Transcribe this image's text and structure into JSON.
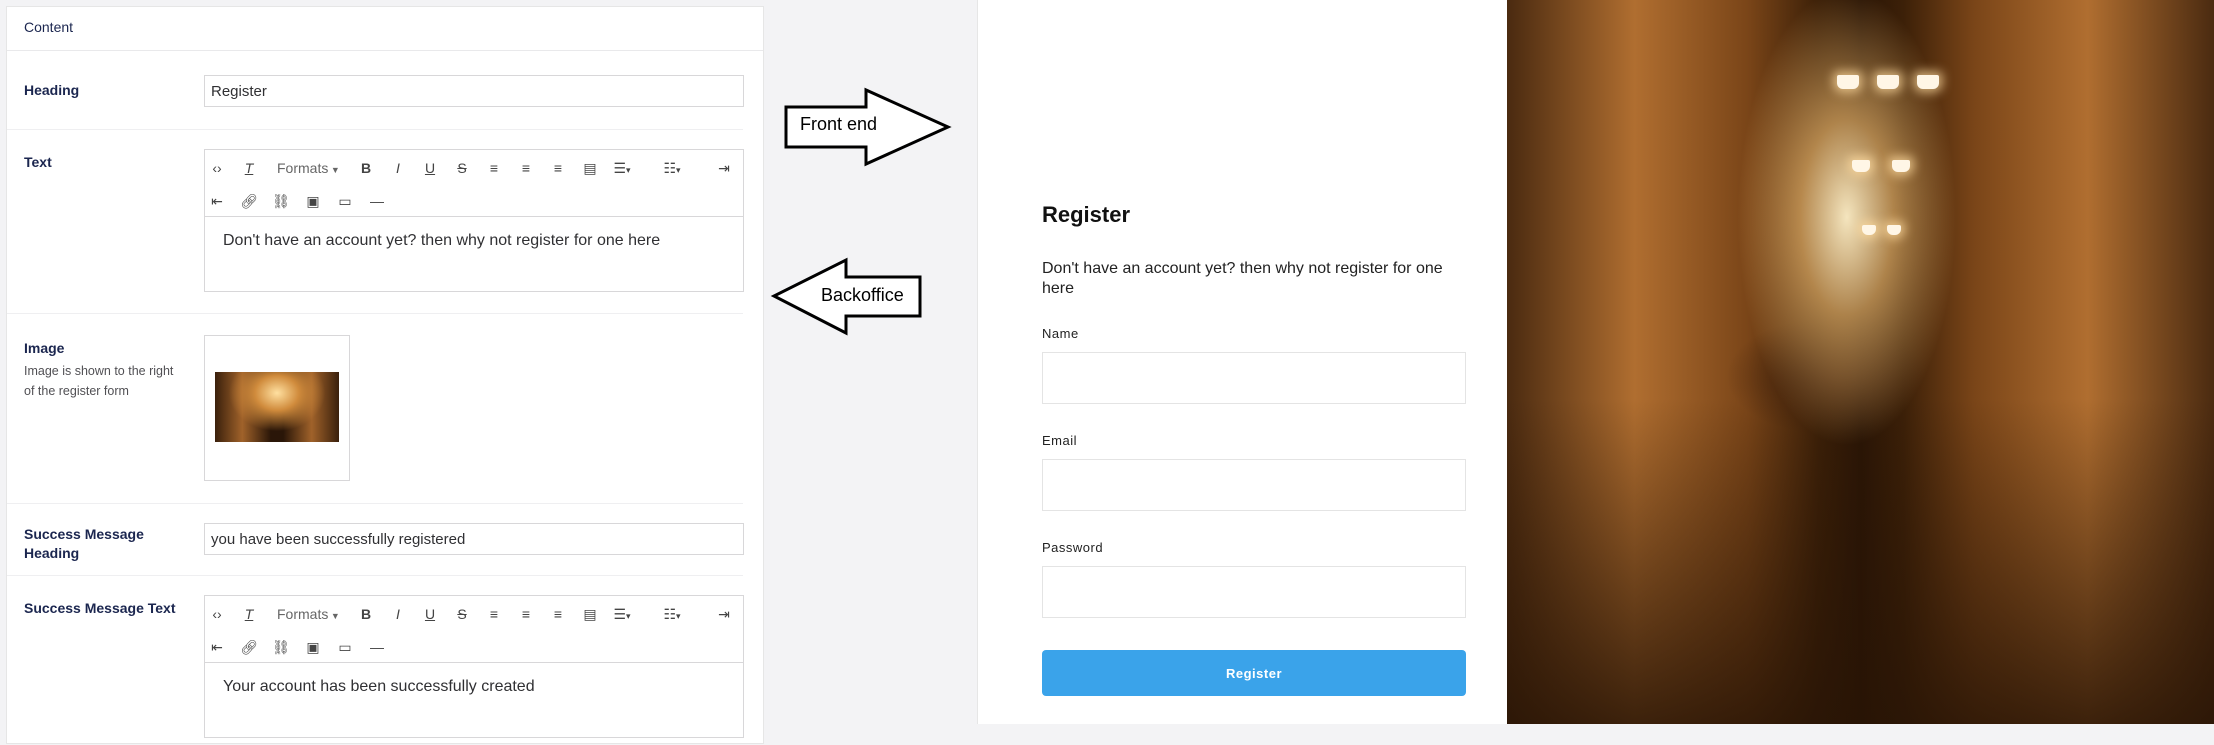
{
  "backoffice": {
    "header": "Content",
    "heading": {
      "label": "Heading",
      "value": "Register"
    },
    "text": {
      "label": "Text",
      "toolbar": {
        "formats": "Formats"
      },
      "value": "Don't have an account yet? then why not register for one here"
    },
    "image": {
      "label": "Image",
      "description": "Image is shown to the right of the register form"
    },
    "success_heading": {
      "label": "Success Message Heading",
      "value": "you have been successfully registered"
    },
    "success_text": {
      "label": "Success Message Text",
      "toolbar": {
        "formats": "Formats"
      },
      "value": "Your account has been successfully created"
    }
  },
  "annotations": {
    "front_end": "Front end",
    "backoffice": "Backoffice"
  },
  "frontend": {
    "title": "Register",
    "text": "Don't have an account yet? then why not register for one here",
    "fields": {
      "name": "Name",
      "email": "Email",
      "password": "Password"
    },
    "submit": "Register"
  },
  "icons": {
    "toolbar": [
      "source-code-icon",
      "clear-format-icon",
      "bold-icon",
      "italic-icon",
      "underline-icon",
      "strikethrough-icon",
      "align-left-icon",
      "align-center-icon",
      "align-right-icon",
      "align-justify-icon",
      "bullet-list-icon",
      "numbered-list-icon",
      "indent-icon",
      "outdent-icon",
      "link-icon",
      "unlink-icon",
      "image-icon",
      "embed-icon",
      "horizontal-rule-icon"
    ]
  },
  "colors": {
    "button": "#3aa3ea",
    "label": "#1b264f"
  }
}
